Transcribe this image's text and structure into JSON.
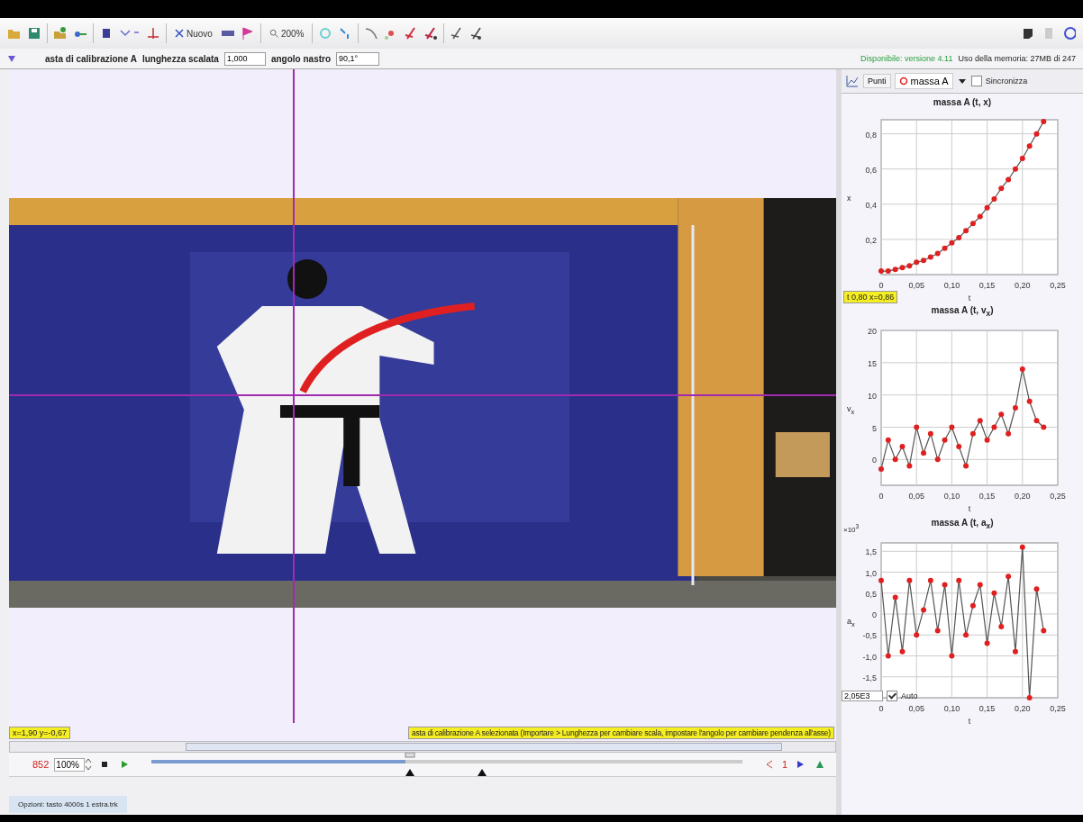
{
  "toolbar": {
    "new_label": "Nuovo",
    "zoom_label": "200%"
  },
  "track_bar": {
    "name": "asta di calibrazione A",
    "length_label": "lunghezza scalata",
    "length_value": "1,000",
    "angle_label": "angolo nastro",
    "angle_value": "90,1°"
  },
  "status_top": {
    "update": "Disponibile: versione 4.11",
    "memory": "Uso della memoria: 27MB di 247"
  },
  "plot_toolbar": {
    "points_label": "Punti",
    "track": "massa A",
    "sync_label": "Sincronizza",
    "sync_checked": false
  },
  "graphs": [
    {
      "title": "massa A (t, x)",
      "readout": "t 0,80  x=0,86",
      "chart_data": {
        "type": "line",
        "grid": true,
        "xlabel": "t",
        "ylabel": "x",
        "x": [
          0,
          0.01,
          0.02,
          0.03,
          0.04,
          0.05,
          0.06,
          0.07,
          0.08,
          0.09,
          0.1,
          0.11,
          0.12,
          0.13,
          0.14,
          0.15,
          0.16,
          0.17,
          0.18,
          0.19,
          0.2,
          0.21,
          0.22,
          0.23
        ],
        "series": [
          {
            "color": "#e02020",
            "marker": "circle",
            "values": [
              0.02,
              0.02,
              0.03,
              0.04,
              0.05,
              0.07,
              0.08,
              0.1,
              0.12,
              0.15,
              0.18,
              0.21,
              0.25,
              0.29,
              0.33,
              0.38,
              0.43,
              0.49,
              0.54,
              0.6,
              0.66,
              0.73,
              0.8,
              0.87
            ]
          }
        ],
        "xlim": [
          0,
          0.25
        ],
        "ylim": [
          0,
          0.88
        ],
        "xticks": [
          {
            "value": 0,
            "label": "0"
          },
          {
            "value": 0.05,
            "label": "0,05"
          },
          {
            "value": 0.1,
            "label": "0,10"
          },
          {
            "value": 0.15,
            "label": "0,15"
          },
          {
            "value": 0.2,
            "label": "0,20"
          },
          {
            "value": 0.25,
            "label": "0,25"
          }
        ],
        "yticks": [
          {
            "value": 0.2,
            "label": "0,2"
          },
          {
            "value": 0.4,
            "label": "0,4"
          },
          {
            "value": 0.6,
            "label": "0,6"
          },
          {
            "value": 0.8,
            "label": "0,8"
          }
        ]
      }
    },
    {
      "title": "massa A (t, v$_{x}$)",
      "chart_data": {
        "type": "line",
        "grid": true,
        "xlabel": "t",
        "ylabel": "v$_{x}$",
        "x": [
          0,
          0.01,
          0.02,
          0.03,
          0.04,
          0.05,
          0.06,
          0.07,
          0.08,
          0.09,
          0.1,
          0.11,
          0.12,
          0.13,
          0.14,
          0.15,
          0.16,
          0.17,
          0.18,
          0.19,
          0.2,
          0.21,
          0.22,
          0.23
        ],
        "series": [
          {
            "color": "#e02020",
            "marker": "circle",
            "values": [
              -1.5,
              3,
              0,
              2,
              -1,
              5,
              1,
              4,
              0,
              3,
              5,
              2,
              -1,
              4,
              6,
              3,
              5,
              7,
              4,
              8,
              14,
              9,
              6,
              5
            ]
          }
        ],
        "xlim": [
          0,
          0.25
        ],
        "ylim": [
          -4,
          20
        ],
        "xticks": [
          {
            "value": 0,
            "label": "0"
          },
          {
            "value": 0.05,
            "label": "0,05"
          },
          {
            "value": 0.1,
            "label": "0,10"
          },
          {
            "value": 0.15,
            "label": "0,15"
          },
          {
            "value": 0.2,
            "label": "0,20"
          },
          {
            "value": 0.25,
            "label": "0,25"
          }
        ],
        "yticks": [
          0,
          5,
          10,
          15,
          20
        ]
      }
    },
    {
      "title": "massa A (t, a$_{x}$)",
      "multiplier": "×10$^{3}$",
      "scale_value": "2,05E3",
      "auto_label": "Auto",
      "auto_checked": true,
      "chart_data": {
        "type": "line",
        "grid": true,
        "xlabel": "t",
        "ylabel": "a$_{x}$",
        "x": [
          0,
          0.01,
          0.02,
          0.03,
          0.04,
          0.05,
          0.06,
          0.07,
          0.08,
          0.09,
          0.1,
          0.11,
          0.12,
          0.13,
          0.14,
          0.15,
          0.16,
          0.17,
          0.18,
          0.19,
          0.2,
          0.21,
          0.22,
          0.23
        ],
        "series": [
          {
            "color": "#e02020",
            "marker": "circle",
            "values": [
              0.8,
              -1,
              0.4,
              -0.9,
              0.8,
              -0.5,
              0.1,
              0.8,
              -0.4,
              0.7,
              -1,
              0.8,
              -0.5,
              0.2,
              0.7,
              -0.7,
              0.5,
              -0.3,
              0.9,
              -0.9,
              1.6,
              -2,
              0.6,
              -0.4
            ]
          }
        ],
        "xlim": [
          0,
          0.25
        ],
        "ylim": [
          -2,
          1.7
        ],
        "xticks": [
          {
            "value": 0,
            "label": "0"
          },
          {
            "value": 0.05,
            "label": "0,05"
          },
          {
            "value": 0.1,
            "label": "0,10"
          },
          {
            "value": 0.15,
            "label": "0,15"
          },
          {
            "value": 0.2,
            "label": "0,20"
          },
          {
            "value": 0.25,
            "label": "0,25"
          }
        ],
        "yticks": [
          {
            "value": 1.5,
            "label": "1,5"
          },
          {
            "value": 1,
            "label": "1,0"
          },
          {
            "value": 0.5,
            "label": "0,5"
          },
          {
            "value": 0,
            "label": "0"
          },
          {
            "value": -0.5,
            "label": "-0,5"
          },
          {
            "value": -1,
            "label": "-1,0"
          },
          {
            "value": -1.5,
            "label": "-1,5"
          }
        ]
      }
    }
  ],
  "video": {
    "kind": "picture",
    "coords": "x=1,90  y=-0,67",
    "message": "asta di calibrazione A selezionata (Importare > Lunghezza per cambiare scala, impostare l'angolo per cambiare pendenza all'asse)"
  },
  "player": {
    "frame": "852",
    "rate": "100%",
    "level": 0.43,
    "step": "1"
  },
  "status_bar": "Opzioni: tasto 4000s  1 estra.trk"
}
